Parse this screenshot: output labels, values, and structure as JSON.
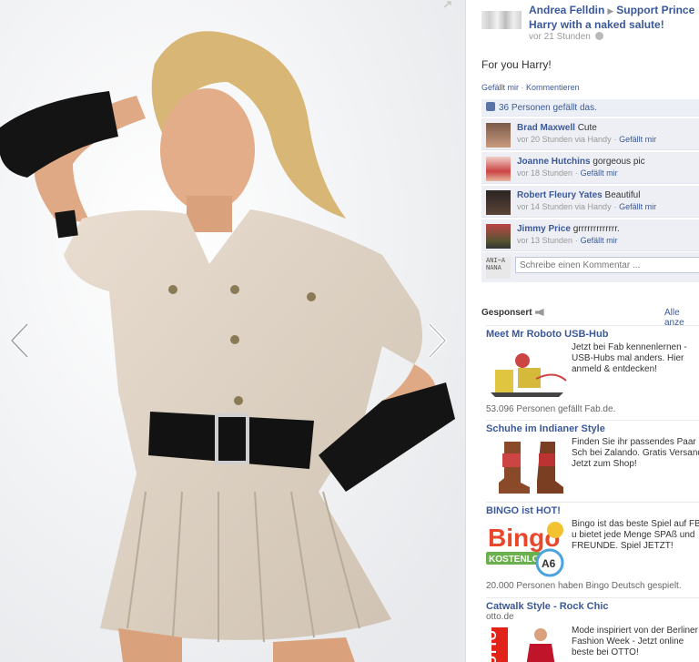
{
  "post": {
    "owner": "Andrea Felldin",
    "target": "Support Prince Harry with a naked salute!",
    "time": "vor 21 Stunden",
    "caption": "For you Harry!",
    "actions": [
      "Gefällt mir",
      "Kommentieren"
    ],
    "likes": "36 Personen gefällt das."
  },
  "comments": [
    {
      "name": "Brad Maxwell",
      "text": "Cute",
      "time": "vor 20 Stunden via Handy",
      "like": "Gefällt mir"
    },
    {
      "name": "Joanne Hutchins",
      "text": "gorgeous pic",
      "time": "vor 18 Stunden",
      "like": "Gefällt mir"
    },
    {
      "name": "Robert Fleury Yates",
      "text": "Beautiful",
      "time": "vor 14 Stunden via Handy",
      "like": "Gefällt mir"
    },
    {
      "name": "Jimmy Price",
      "text": "grrrrrrrrrrrrr.",
      "time": "vor 13 Stunden",
      "like": "Gefällt mir"
    }
  ],
  "write": {
    "avatar_text": "ANI~A NANA",
    "placeholder": "Schreibe einen Kommentar ..."
  },
  "sponsored": {
    "title": "Gesponsert",
    "see_all": "Alle anze",
    "ads": [
      {
        "title": "Meet Mr Roboto USB-Hub",
        "sub": "",
        "text": "Jetzt bei Fab kennenlernen - USB-Hubs mal anders. Hier anmeld & entdecken!",
        "social": "53.096 Personen gefällt Fab.de."
      },
      {
        "title": "Schuhe im Indianer Style",
        "sub": "",
        "text": "Finden Sie ihr passendes Paar Sch bei Zalando. Gratis Versand. Jetzt zum Shop!",
        "social": ""
      },
      {
        "title": "BINGO ist HOT!",
        "sub": "",
        "text": "Bingo ist das beste Spiel auf FB u bietet jede Menge SPAß und FREUNDE. Spiel JETZT!",
        "social": "20.000 Personen haben Bingo Deutsch gespielt."
      },
      {
        "title": "Catwalk Style - Rock Chic",
        "sub": "otto.de",
        "text": "Mode inspiriert von der Berliner Fashion Week - Jetzt online beste bei OTTO!",
        "social": ""
      }
    ],
    "ad_image_labels": {
      "bingo": "Bingo",
      "bingo_badge": "KOSTENLOS",
      "bingo_ball": "A6",
      "otto": "OTTO"
    }
  },
  "icons": [
    "expand-icon",
    "chevron-left-icon",
    "chevron-right-icon",
    "globe-icon",
    "thumbs-up-icon",
    "megaphone-icon"
  ],
  "colors": {
    "link": "#3b5998",
    "comment_bg": "#edeff4",
    "likes_bg": "#eceff5"
  }
}
